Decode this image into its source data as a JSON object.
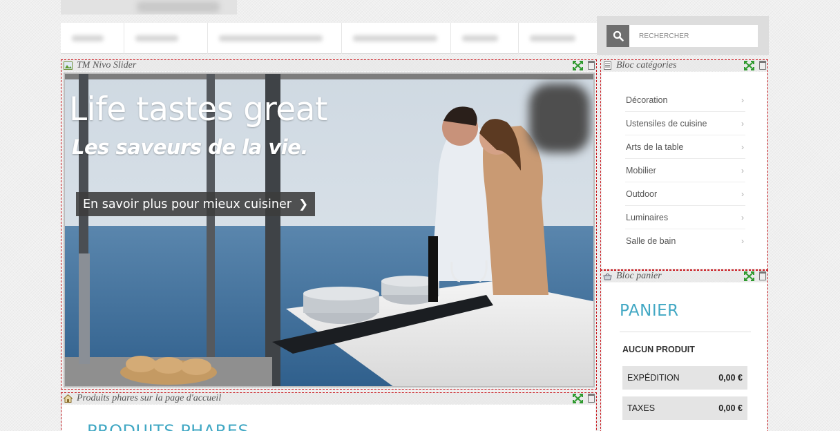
{
  "search": {
    "placeholder": "RECHERCHER"
  },
  "modules": {
    "slider": "TM Nivo Slider",
    "categories": "Bloc catégories",
    "cart": "Bloc panier",
    "featured": "Produits phares sur la page d'accueil"
  },
  "slide": {
    "headline": "Life tastes great",
    "subheadline": "Les saveurs de la vie.",
    "cta": "En savoir plus pour mieux cuisiner",
    "cta_icon": "chevron-right-icon"
  },
  "categories": [
    "Décoration",
    "Ustensiles de cuisine",
    "Arts de la table",
    "Mobilier",
    "Outdoor",
    "Luminaires",
    "Salle de bain"
  ],
  "cart": {
    "title": "PANIER",
    "empty_label": "AUCUN PRODUIT",
    "rows": [
      {
        "label": "EXPÉDITION",
        "amount": "0,00 €"
      },
      {
        "label": "TAXES",
        "amount": "0,00 €"
      }
    ]
  },
  "featured": {
    "title": "PRODUITS PHARES"
  },
  "colors": {
    "accent": "#42a8c4",
    "module_border": "#c8151b",
    "button_dark": "#6e6e6e"
  }
}
